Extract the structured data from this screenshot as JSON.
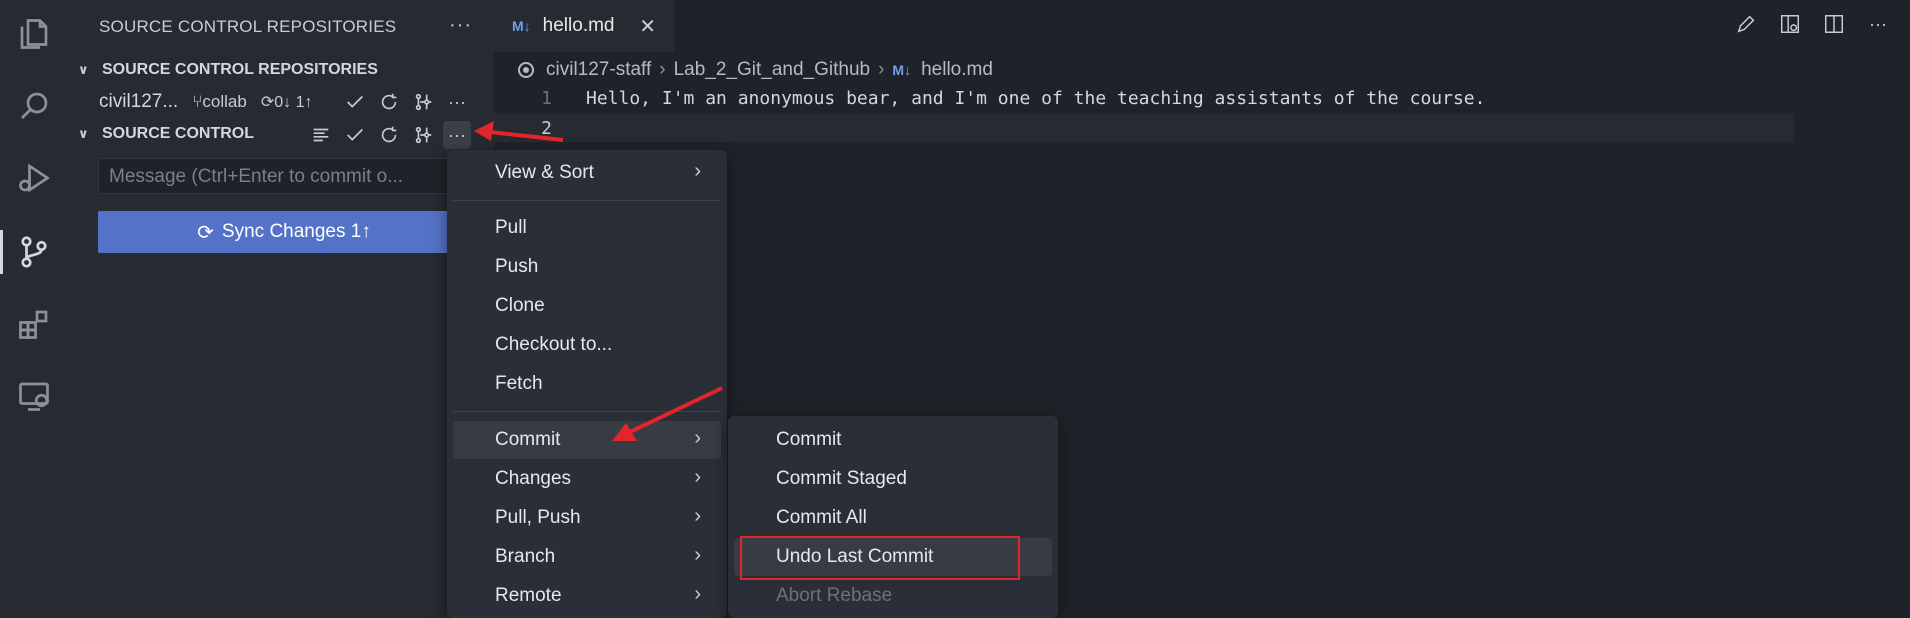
{
  "activity_bar": {
    "items": [
      {
        "icon": "explorer-icon"
      },
      {
        "icon": "search-icon"
      },
      {
        "icon": "run-debug-icon"
      },
      {
        "icon": "source-control-icon",
        "active": true
      },
      {
        "icon": "extensions-icon"
      },
      {
        "icon": "remote-explorer-icon"
      }
    ]
  },
  "sidebar": {
    "title": "SOURCE CONTROL REPOSITORIES",
    "more_label": "···",
    "repositories_section": {
      "label": "SOURCE CONTROL REPOSITORIES",
      "repo_name": "civil127...",
      "branch": "collab",
      "sync_status": "0↓ 1↑"
    },
    "source_control_section": {
      "label": "SOURCE CONTROL",
      "message_placeholder": "Message (Ctrl+Enter to commit o...",
      "sync_button": "Sync Changes 1↑"
    }
  },
  "editor": {
    "tab": {
      "label": "hello.md",
      "badge": "M↓",
      "close": "✕"
    },
    "breadcrumb": [
      "civil127-staff",
      "Lab_2_Git_and_Github",
      "hello.md"
    ],
    "lines": [
      {
        "num": "1",
        "text": "Hello, I'm an anonymous bear, and I'm one of the teaching assistants of the course."
      },
      {
        "num": "2",
        "text": ""
      }
    ]
  },
  "menu": {
    "items": [
      {
        "label": "View & Sort",
        "submenu": true
      },
      {
        "label": "Pull"
      },
      {
        "label": "Push"
      },
      {
        "label": "Clone"
      },
      {
        "label": "Checkout to..."
      },
      {
        "label": "Fetch"
      },
      {
        "label": "Commit",
        "submenu": true,
        "highlighted": true
      },
      {
        "label": "Changes",
        "submenu": true
      },
      {
        "label": "Pull, Push",
        "submenu": true
      },
      {
        "label": "Branch",
        "submenu": true
      },
      {
        "label": "Remote",
        "submenu": true
      }
    ],
    "arrow_glyph": "›"
  },
  "submenu": {
    "items": [
      {
        "label": "Commit"
      },
      {
        "label": "Commit Staged"
      },
      {
        "label": "Commit All"
      },
      {
        "label": "Undo Last Commit",
        "highlighted": true
      },
      {
        "label": "Abort Rebase",
        "disabled": true
      }
    ]
  },
  "colors": {
    "accent_button": "#5473c8",
    "annotation_red": "#e0262b",
    "markdown_icon": "#6fa0e8"
  }
}
